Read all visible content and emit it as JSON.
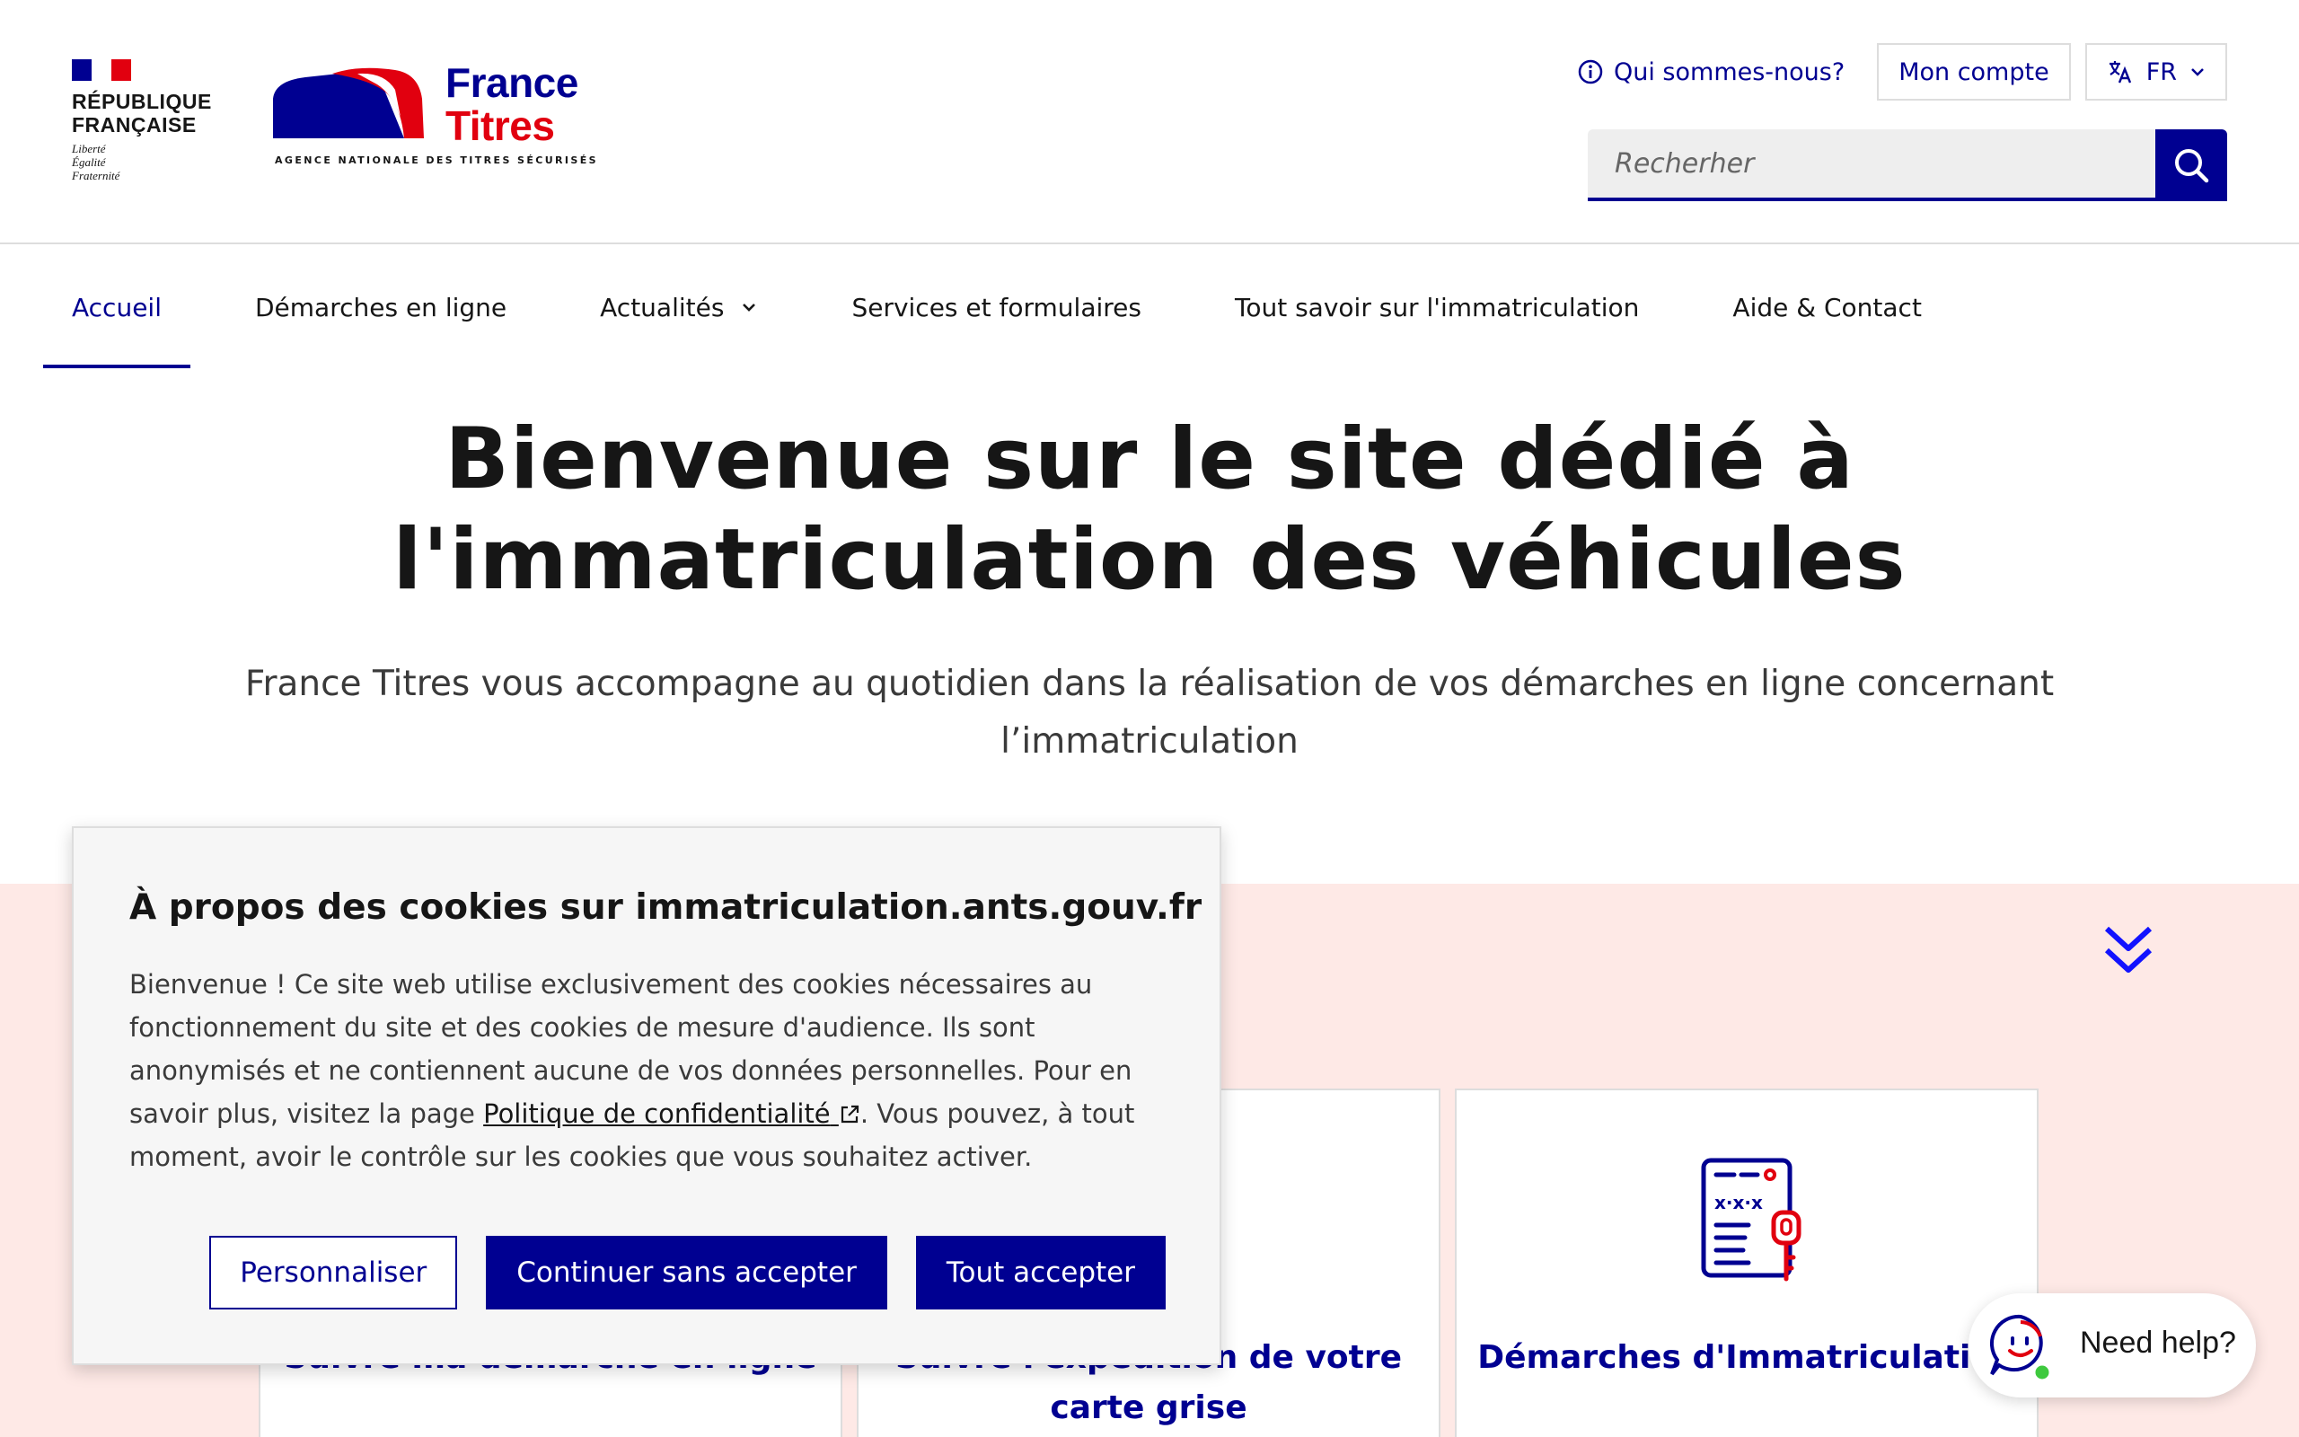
{
  "header": {
    "republic_line1": "RÉPUBLIQUE",
    "republic_line2": "FRANÇAISE",
    "motto": [
      "Liberté",
      "Égalité",
      "Fraternité"
    ],
    "brand_line1": "France",
    "brand_line2": "Titres",
    "brand_tagline": "AGENCE NATIONALE DES TITRES SÉCURISÉS",
    "about_link": "Qui sommes-nous?",
    "account_button": "Mon compte",
    "language": "FR",
    "search_placeholder": "Recherher"
  },
  "nav": {
    "items": [
      {
        "label": "Accueil",
        "active": true
      },
      {
        "label": "Démarches en ligne"
      },
      {
        "label": "Actualités",
        "has_dropdown": true
      },
      {
        "label": "Services et formulaires"
      },
      {
        "label": "Tout savoir sur l'immatriculation"
      },
      {
        "label": "Aide & Contact"
      }
    ]
  },
  "hero": {
    "title_line1": "Bienvenue sur le site dédié à",
    "title_line2": "l'immatriculation des véhicules",
    "subtitle_line1": "France Titres vous accompagne au quotidien dans la réalisation de vos démarches en ligne concernant",
    "subtitle_line2": "l’immatriculation"
  },
  "cards": [
    {
      "title": "Suivre ma démarche en ligne"
    },
    {
      "title_line1": "Suivre l'expédition de votre",
      "title_line2": "carte grise"
    },
    {
      "title": "Démarches d'Immatriculation"
    }
  ],
  "cookie_banner": {
    "title": "À propos des cookies sur immatriculation.ants.gouv.fr",
    "text_before_link": "Bienvenue ! Ce site web utilise exclusivement des cookies nécessaires au fonctionnement du site et des cookies de mesure d'audience. Ils sont anonymisés et ne contiennent aucune de vos données personnelles. Pour en savoir plus, visitez la page ",
    "link_text": "Politique de confidentialité",
    "text_after_link": ". Vous pouvez, à tout moment, avoir le contrôle sur les cookies que vous souhaitez activer.",
    "btn_customize": "Personnaliser",
    "btn_continue": "Continuer sans accepter",
    "btn_accept_all": "Tout accepter"
  },
  "chat": {
    "label": "Need help?"
  },
  "colors": {
    "primary": "#000091",
    "red": "#e1000f",
    "pink_bg": "#fee9e6"
  }
}
